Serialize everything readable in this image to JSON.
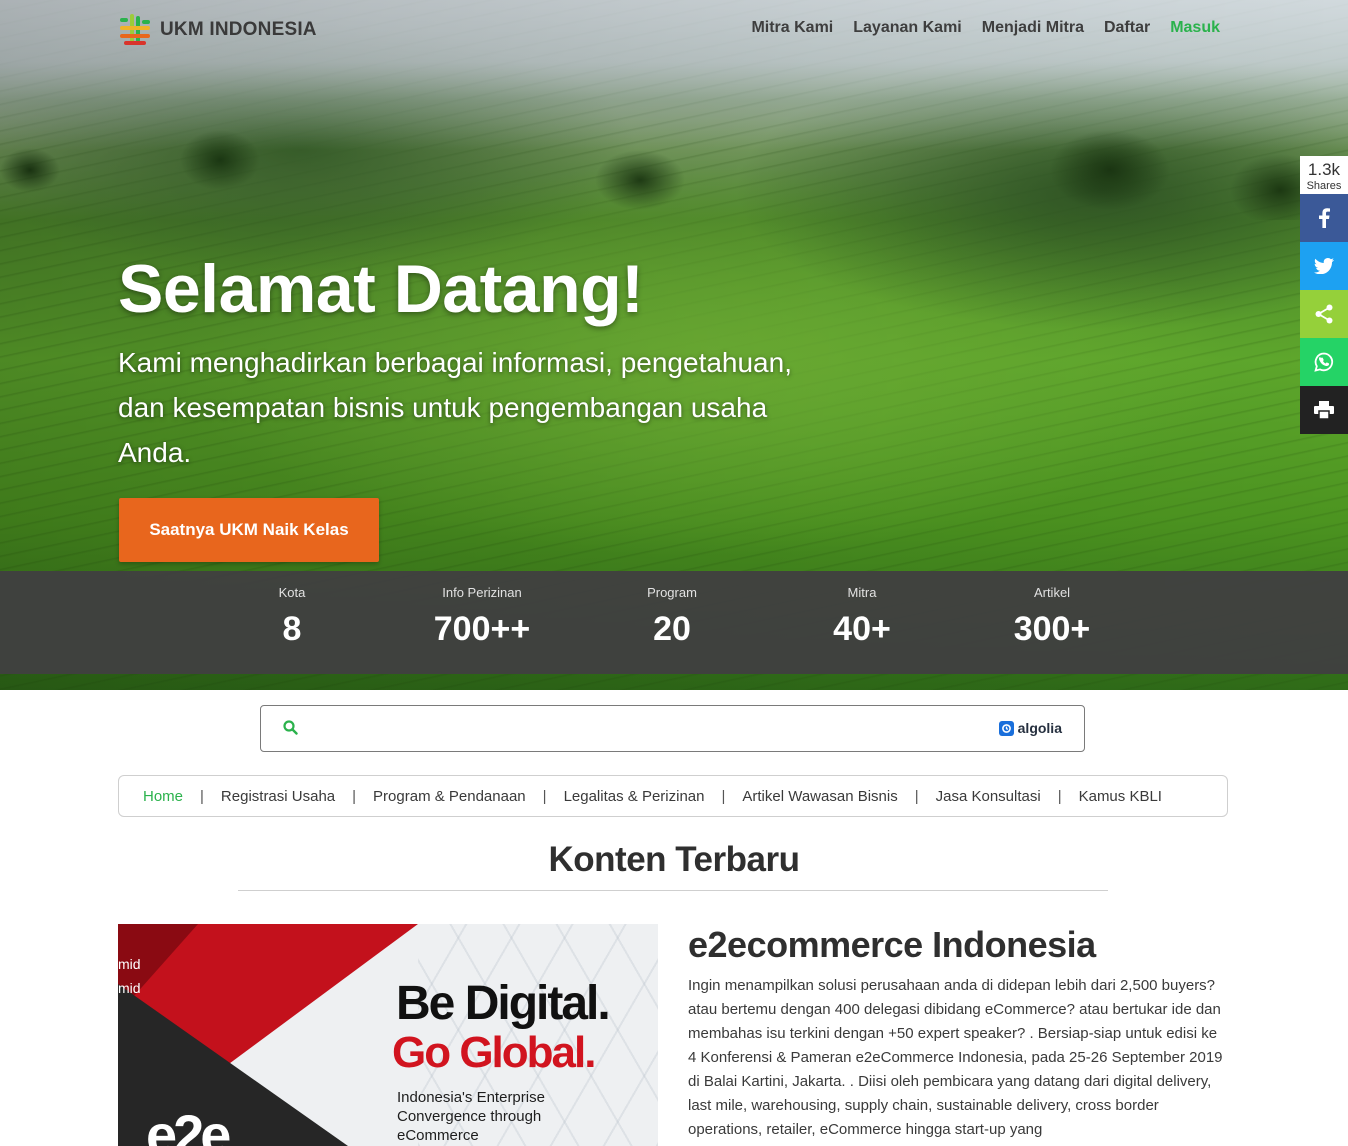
{
  "brand": {
    "name": "UKM INDONESIA"
  },
  "nav": {
    "items": [
      {
        "label": "Mitra Kami",
        "active": false
      },
      {
        "label": "Layanan Kami",
        "active": false
      },
      {
        "label": "Menjadi Mitra",
        "active": false
      },
      {
        "label": "Daftar",
        "active": false
      },
      {
        "label": "Masuk",
        "active": true
      }
    ]
  },
  "hero": {
    "title": "Selamat Datang!",
    "subtitle": "Kami menghadirkan berbagai informasi, pengetahuan, dan kesempatan bisnis untuk pengembangan usaha Anda.",
    "cta_label": "Saatnya UKM Naik Kelas"
  },
  "stats": [
    {
      "label": "Kota",
      "value": "8"
    },
    {
      "label": "Info Perizinan",
      "value": "700++"
    },
    {
      "label": "Program",
      "value": "20"
    },
    {
      "label": "Mitra",
      "value": "40+"
    },
    {
      "label": "Artikel",
      "value": "300+"
    }
  ],
  "share": {
    "count": "1.3k",
    "count_label": "Shares",
    "buttons": [
      {
        "icon": "facebook-icon",
        "color": "#3b5998"
      },
      {
        "icon": "twitter-icon",
        "color": "#1da1f2"
      },
      {
        "icon": "share-icon",
        "color": "#95d03a"
      },
      {
        "icon": "whatsapp-icon",
        "color": "#25d366"
      },
      {
        "icon": "print-icon",
        "color": "#222222"
      }
    ]
  },
  "search": {
    "placeholder": "",
    "value": "",
    "powered_by": "algolia"
  },
  "subnav": {
    "items": [
      {
        "label": "Home",
        "active": true
      },
      {
        "label": "Registrasi Usaha",
        "active": false
      },
      {
        "label": "Program & Pendanaan",
        "active": false
      },
      {
        "label": "Legalitas & Perizinan",
        "active": false
      },
      {
        "label": "Artikel Wawasan Bisnis",
        "active": false
      },
      {
        "label": "Jasa Konsultasi",
        "active": false
      },
      {
        "label": "Kamus KBLI",
        "active": false
      }
    ]
  },
  "section": {
    "title": "Konten Terbaru"
  },
  "article": {
    "title": "e2ecommerce Indonesia",
    "excerpt": "Ingin menampilkan solusi perusahaan anda di didepan lebih dari 2,500 buyers? atau bertemu dengan 400 delegasi dibidang eCommerce? atau bertukar ide dan membahas isu terkini dengan +50 expert speaker? . Bersiap-siap untuk edisi ke 4 Konferensi & Pameran e2eCommerce Indonesia, pada 25-26 September 2019 di Balai Kartini, Jakarta. . Diisi oleh pembicara yang datang dari digital delivery, last mile, warehousing, supply chain, sustainable delivery, cross border operations, retailer, eCommerce hingga start-up yang",
    "image": {
      "mid_1": "mid",
      "mid_2": "mid",
      "logo_text": "e2e",
      "headline_1": "Be Digital.",
      "headline_2": "Go Global.",
      "tagline": "Indonesia's Enterprise Convergence through eCommerce"
    }
  },
  "colors": {
    "accent": "#2bb24c",
    "cta": "#e8661d",
    "stats_bg": "#404040"
  }
}
